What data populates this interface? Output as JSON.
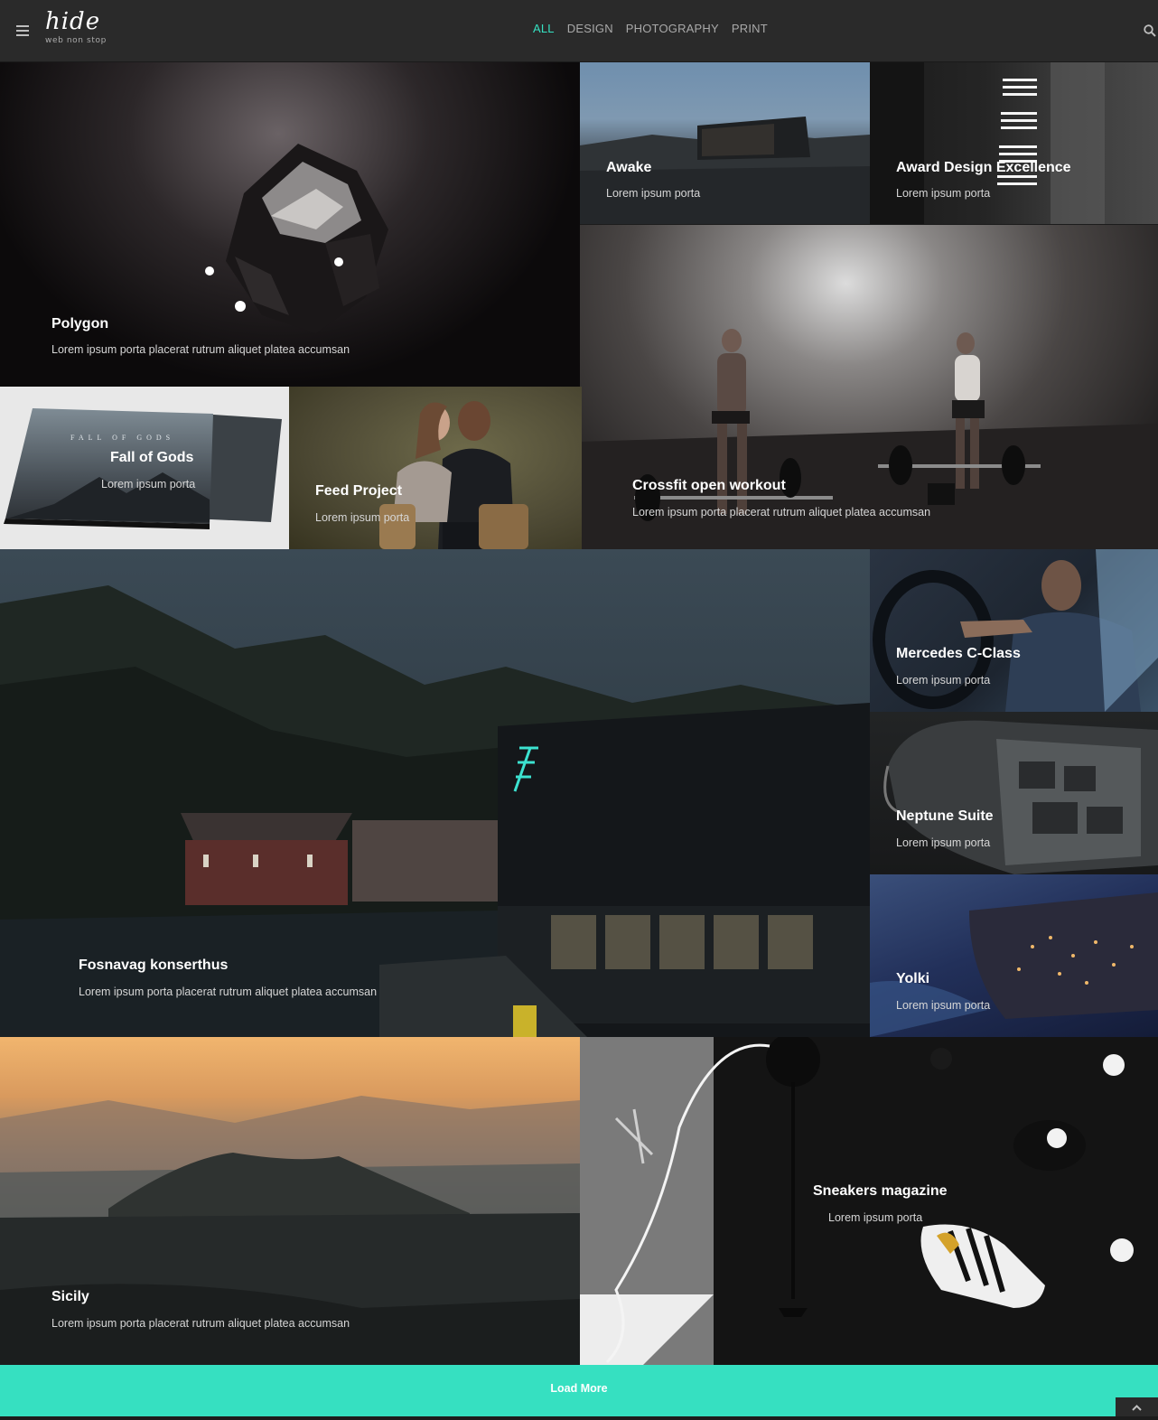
{
  "header": {
    "logo_word": "hide",
    "logo_tagline": "web non stop",
    "nav": [
      "ALL",
      "DESIGN",
      "PHOTOGRAPHY",
      "PRINT"
    ],
    "active_nav": "ALL"
  },
  "colors": {
    "accent": "#36e0c1",
    "header_bg": "#2a2a2a"
  },
  "portfolio": {
    "items": [
      {
        "title": "Polygon",
        "desc": "Lorem ipsum porta placerat rutrum aliquet platea accumsan"
      },
      {
        "title": "Awake",
        "desc": "Lorem ipsum porta"
      },
      {
        "title": "Award Design Excellence",
        "desc": "Lorem ipsum porta"
      },
      {
        "title": "Crossfit open workout",
        "desc": "Lorem ipsum porta placerat rutrum aliquet platea accumsan"
      },
      {
        "title": "Fall of Gods",
        "desc": "Lorem ipsum porta",
        "cover_text": "FALL OF GODS"
      },
      {
        "title": "Feed Project",
        "desc": "Lorem ipsum porta"
      },
      {
        "title": "Fosnavag konserthus",
        "desc": "Lorem ipsum porta placerat rutrum aliquet platea accumsan"
      },
      {
        "title": "Mercedes C-Class",
        "desc": "Lorem ipsum porta"
      },
      {
        "title": "Neptune Suite",
        "desc": "Lorem ipsum porta"
      },
      {
        "title": "Yolki",
        "desc": "Lorem ipsum porta"
      },
      {
        "title": "Sicily",
        "desc": "Lorem ipsum porta placerat rutrum aliquet platea accumsan"
      },
      {
        "title": "Sneakers magazine",
        "desc": "Lorem ipsum porta"
      }
    ]
  },
  "load_more_label": "Load More"
}
